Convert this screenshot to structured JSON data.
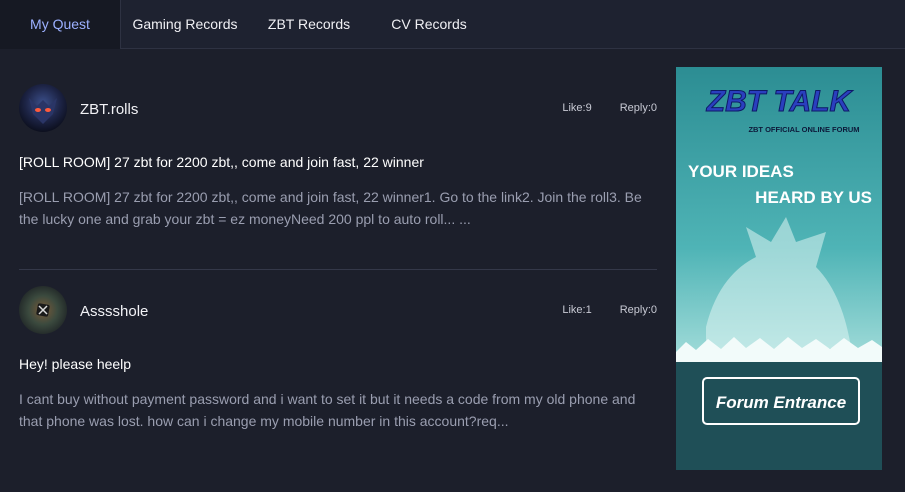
{
  "tabs": [
    {
      "label": "My Quest",
      "active": true
    },
    {
      "label": "Gaming Records",
      "active": false
    },
    {
      "label": "ZBT Records",
      "active": false
    },
    {
      "label": "CV Records",
      "active": false
    }
  ],
  "posts": [
    {
      "author": "ZBT.rolls",
      "likes": "Like:9",
      "replies": "Reply:0",
      "title": "[ROLL ROOM] 27 zbt for 2200 zbt,, come and join fast, 22 winner",
      "excerpt": "[ROLL ROOM] 27 zbt for 2200 zbt,, come and join fast, 22 winner1. Go to the link2. Join the roll3. Be the lucky one and grab your zbt = ez moneyNeed 200 ppl to auto roll... ..."
    },
    {
      "author": "Asssshole",
      "likes": "Like:1",
      "replies": "Reply:0",
      "title": "Hey! please heelp",
      "excerpt": "I cant buy without payment password and i want to set it but it needs a code from my old phone and that phone was lost. how can i change my mobile number in this account?req..."
    }
  ],
  "banner": {
    "logo": "ZBT TALK",
    "subtitle": "ZBT OFFICIAL ONLINE FORUM",
    "tagline_1": "YOUR IDEAS",
    "tagline_2": "HEARD BY US",
    "button": "Forum Entrance"
  },
  "colors": {
    "background": "#1c1f2b",
    "tab_active_text": "#9cb0ff",
    "banner_teal": "#3aa3a6",
    "logo_blue": "#2a3fbf"
  }
}
